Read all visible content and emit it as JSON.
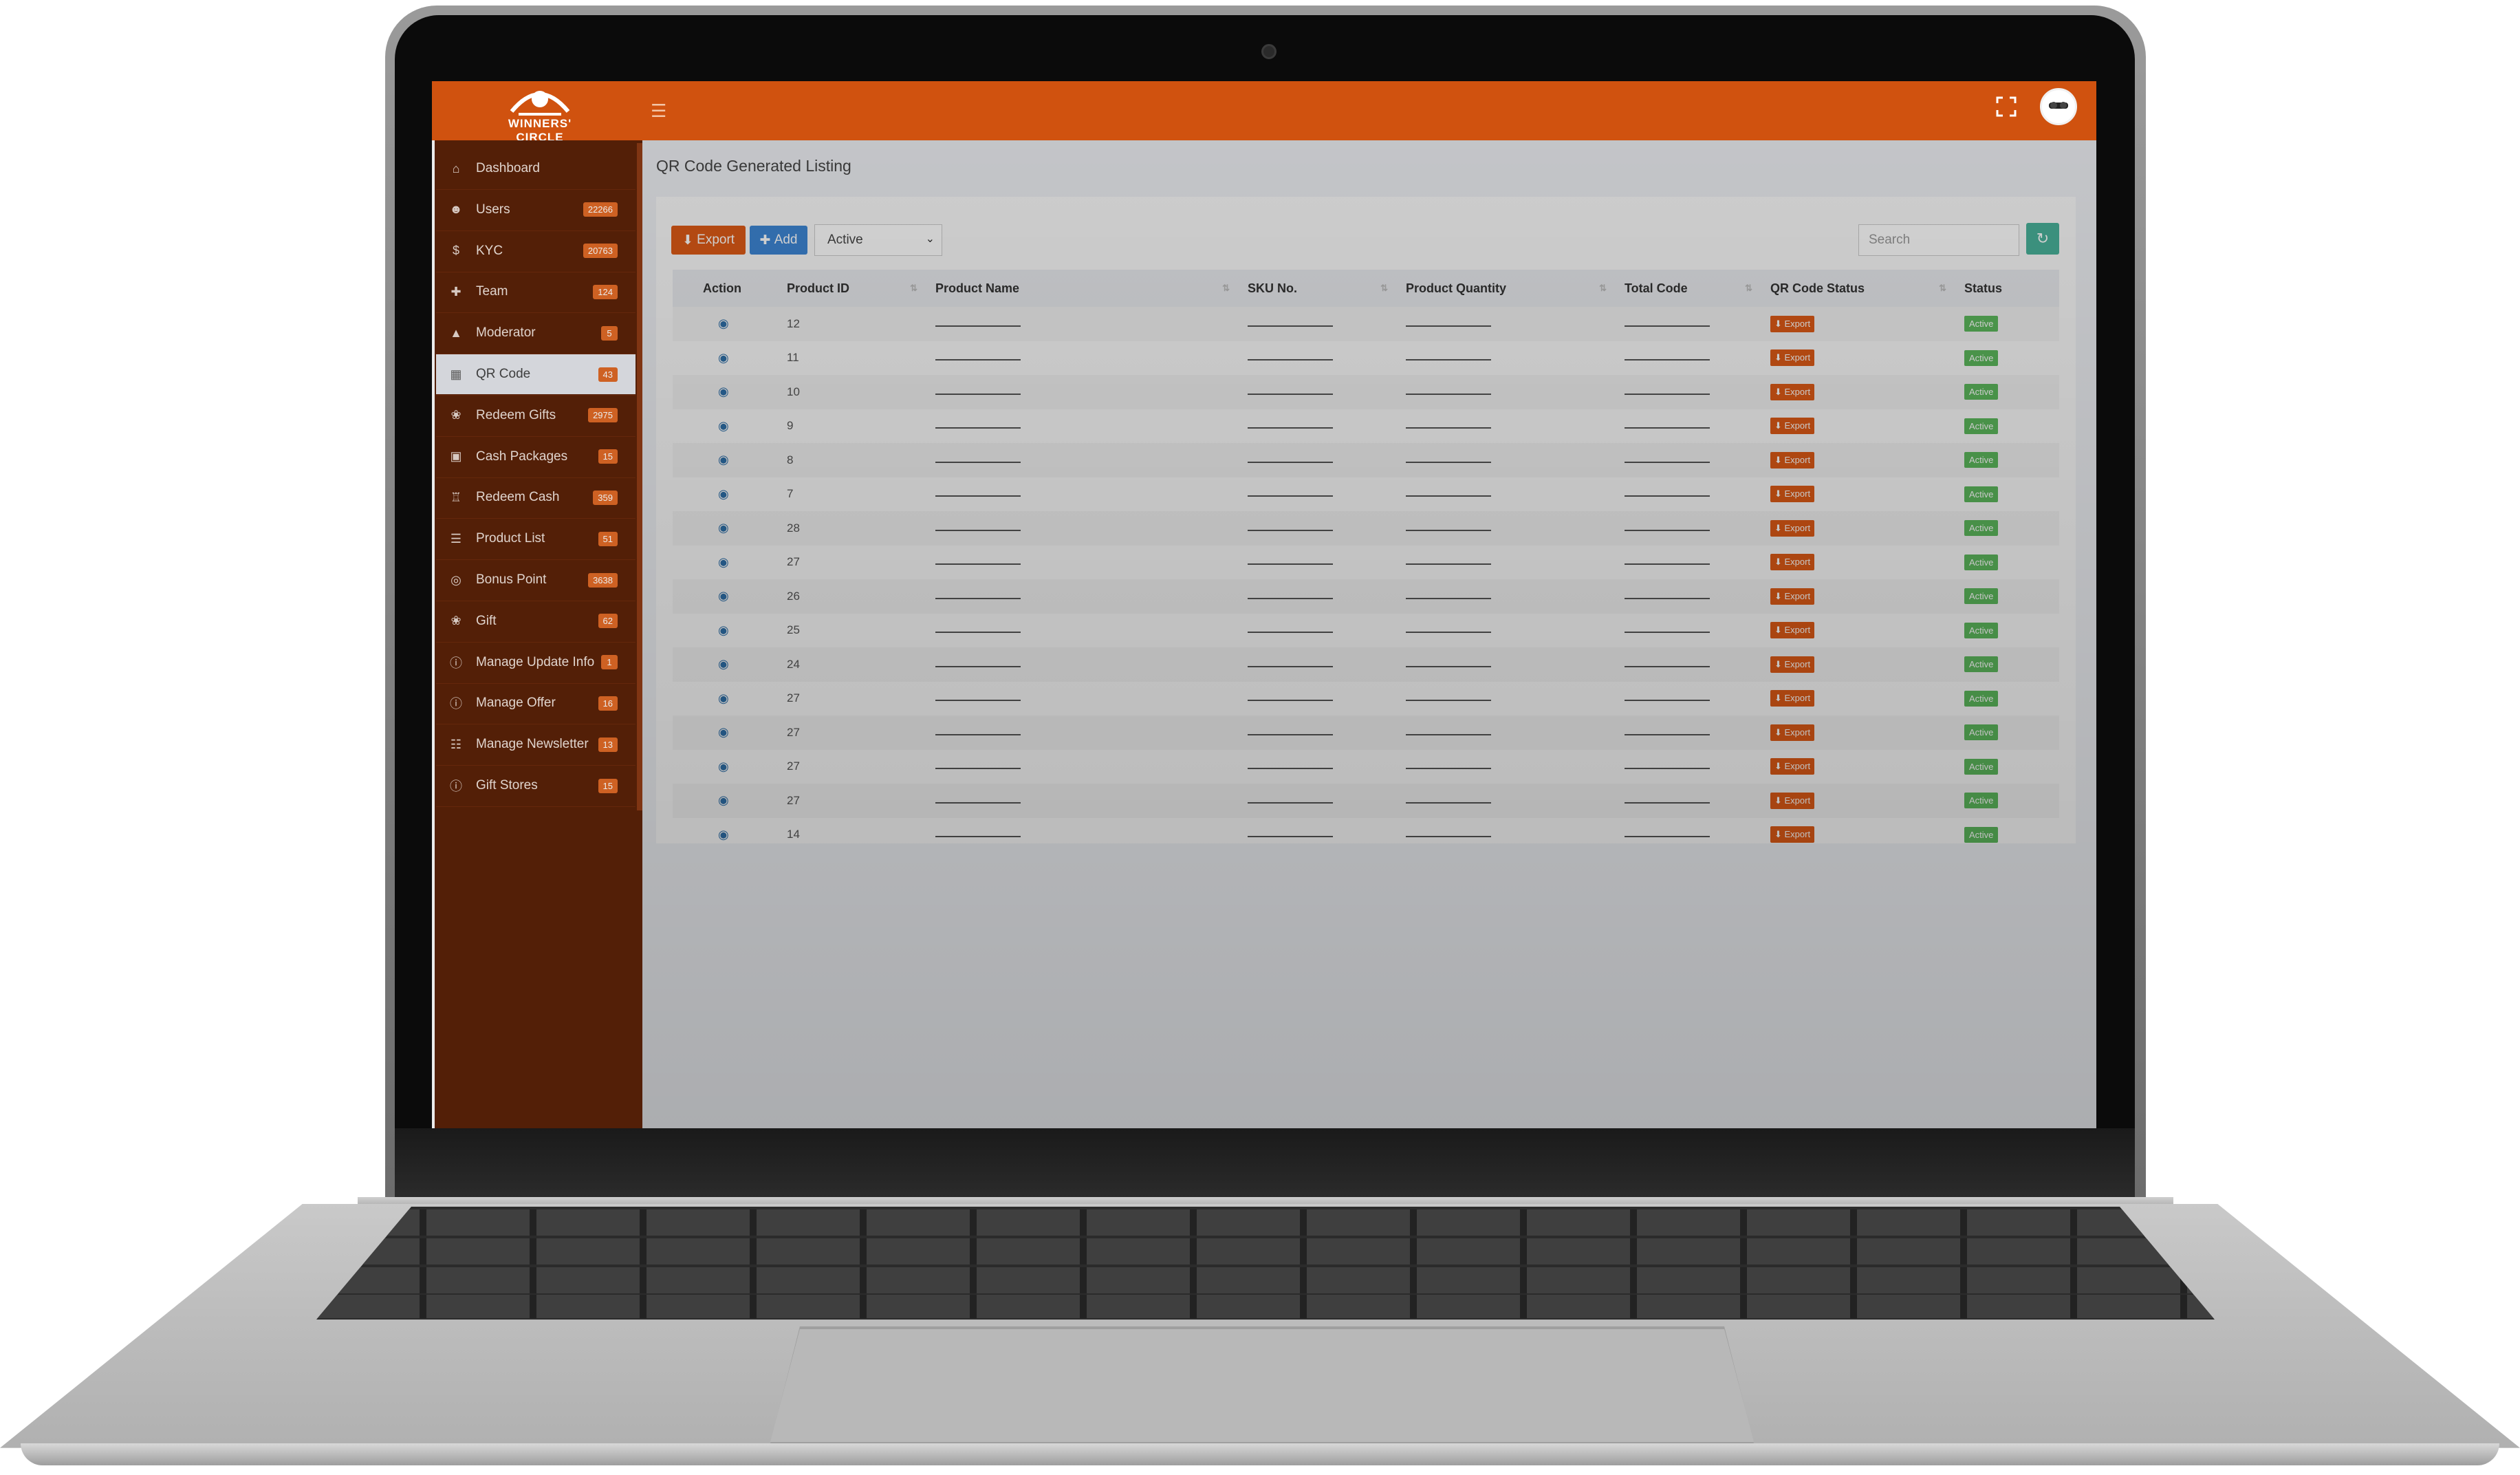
{
  "brand": {
    "logo_text": "WINNERS' CIRCLE"
  },
  "topbar": {
    "menu_icon": "hamburger-icon",
    "fullscreen_icon": "expand-icon"
  },
  "sidebar": {
    "items": [
      {
        "label": "Dashboard",
        "badge": "",
        "icon": "home-icon"
      },
      {
        "label": "Users",
        "badge": "22266",
        "icon": "users-icon"
      },
      {
        "label": "KYC",
        "badge": "20763",
        "icon": "dollar-icon"
      },
      {
        "label": "Team",
        "badge": "124",
        "icon": "user-plus-icon"
      },
      {
        "label": "Moderator",
        "badge": "5",
        "icon": "user-secret-icon"
      },
      {
        "label": "QR Code",
        "badge": "43",
        "icon": "qrcode-icon"
      },
      {
        "label": "Redeem Gifts",
        "badge": "2975",
        "icon": "gift-icon"
      },
      {
        "label": "Cash Packages",
        "badge": "15",
        "icon": "money-icon"
      },
      {
        "label": "Redeem Cash",
        "badge": "359",
        "icon": "bank-icon"
      },
      {
        "label": "Product List",
        "badge": "51",
        "icon": "list-icon"
      },
      {
        "label": "Bonus Point",
        "badge": "3638",
        "icon": "coins-icon"
      },
      {
        "label": "Gift",
        "badge": "62",
        "icon": "gift-icon"
      },
      {
        "label": "Manage Update Info",
        "badge": "1",
        "icon": "info-icon"
      },
      {
        "label": "Manage Offer",
        "badge": "16",
        "icon": "info-icon"
      },
      {
        "label": "Manage Newsletter",
        "badge": "13",
        "icon": "newspaper-icon"
      },
      {
        "label": "Gift Stores",
        "badge": "15",
        "icon": "info-icon"
      }
    ],
    "active_index": 5
  },
  "page": {
    "title": "QR Code Generated Listing"
  },
  "toolbar": {
    "export_label": "Export",
    "add_label": "Add",
    "status_filter": "Active",
    "search_placeholder": "Search"
  },
  "table": {
    "columns": [
      "Action",
      "Product ID",
      "Product Name",
      "SKU No.",
      "Product Quantity",
      "Total Code",
      "QR Code Status",
      "Status"
    ],
    "rows": [
      {
        "id": "12",
        "qr_status": "Export",
        "status": "Active"
      },
      {
        "id": "11",
        "qr_status": "Export",
        "status": "Active"
      },
      {
        "id": "10",
        "qr_status": "Export",
        "status": "Active"
      },
      {
        "id": "9",
        "qr_status": "Export",
        "status": "Active"
      },
      {
        "id": "8",
        "qr_status": "Export",
        "status": "Active"
      },
      {
        "id": "7",
        "qr_status": "Export",
        "status": "Active"
      },
      {
        "id": "28",
        "qr_status": "Export",
        "status": "Active"
      },
      {
        "id": "27",
        "qr_status": "Export",
        "status": "Active"
      },
      {
        "id": "26",
        "qr_status": "Export",
        "status": "Active"
      },
      {
        "id": "25",
        "qr_status": "Export",
        "status": "Active"
      },
      {
        "id": "24",
        "qr_status": "Export",
        "status": "Active"
      },
      {
        "id": "27",
        "qr_status": "Export",
        "status": "Active"
      },
      {
        "id": "27",
        "qr_status": "Export",
        "status": "Active"
      },
      {
        "id": "27",
        "qr_status": "Export",
        "status": "Active"
      },
      {
        "id": "27",
        "qr_status": "Export",
        "status": "Active"
      },
      {
        "id": "14",
        "qr_status": "Export",
        "status": "Active"
      }
    ]
  },
  "colors": {
    "topbar": "#d0520f",
    "sidebar": "#5b2208",
    "export": "#dd5a16",
    "add": "#3d86d4",
    "active": "#5cb85c",
    "refresh": "#49b29a"
  }
}
